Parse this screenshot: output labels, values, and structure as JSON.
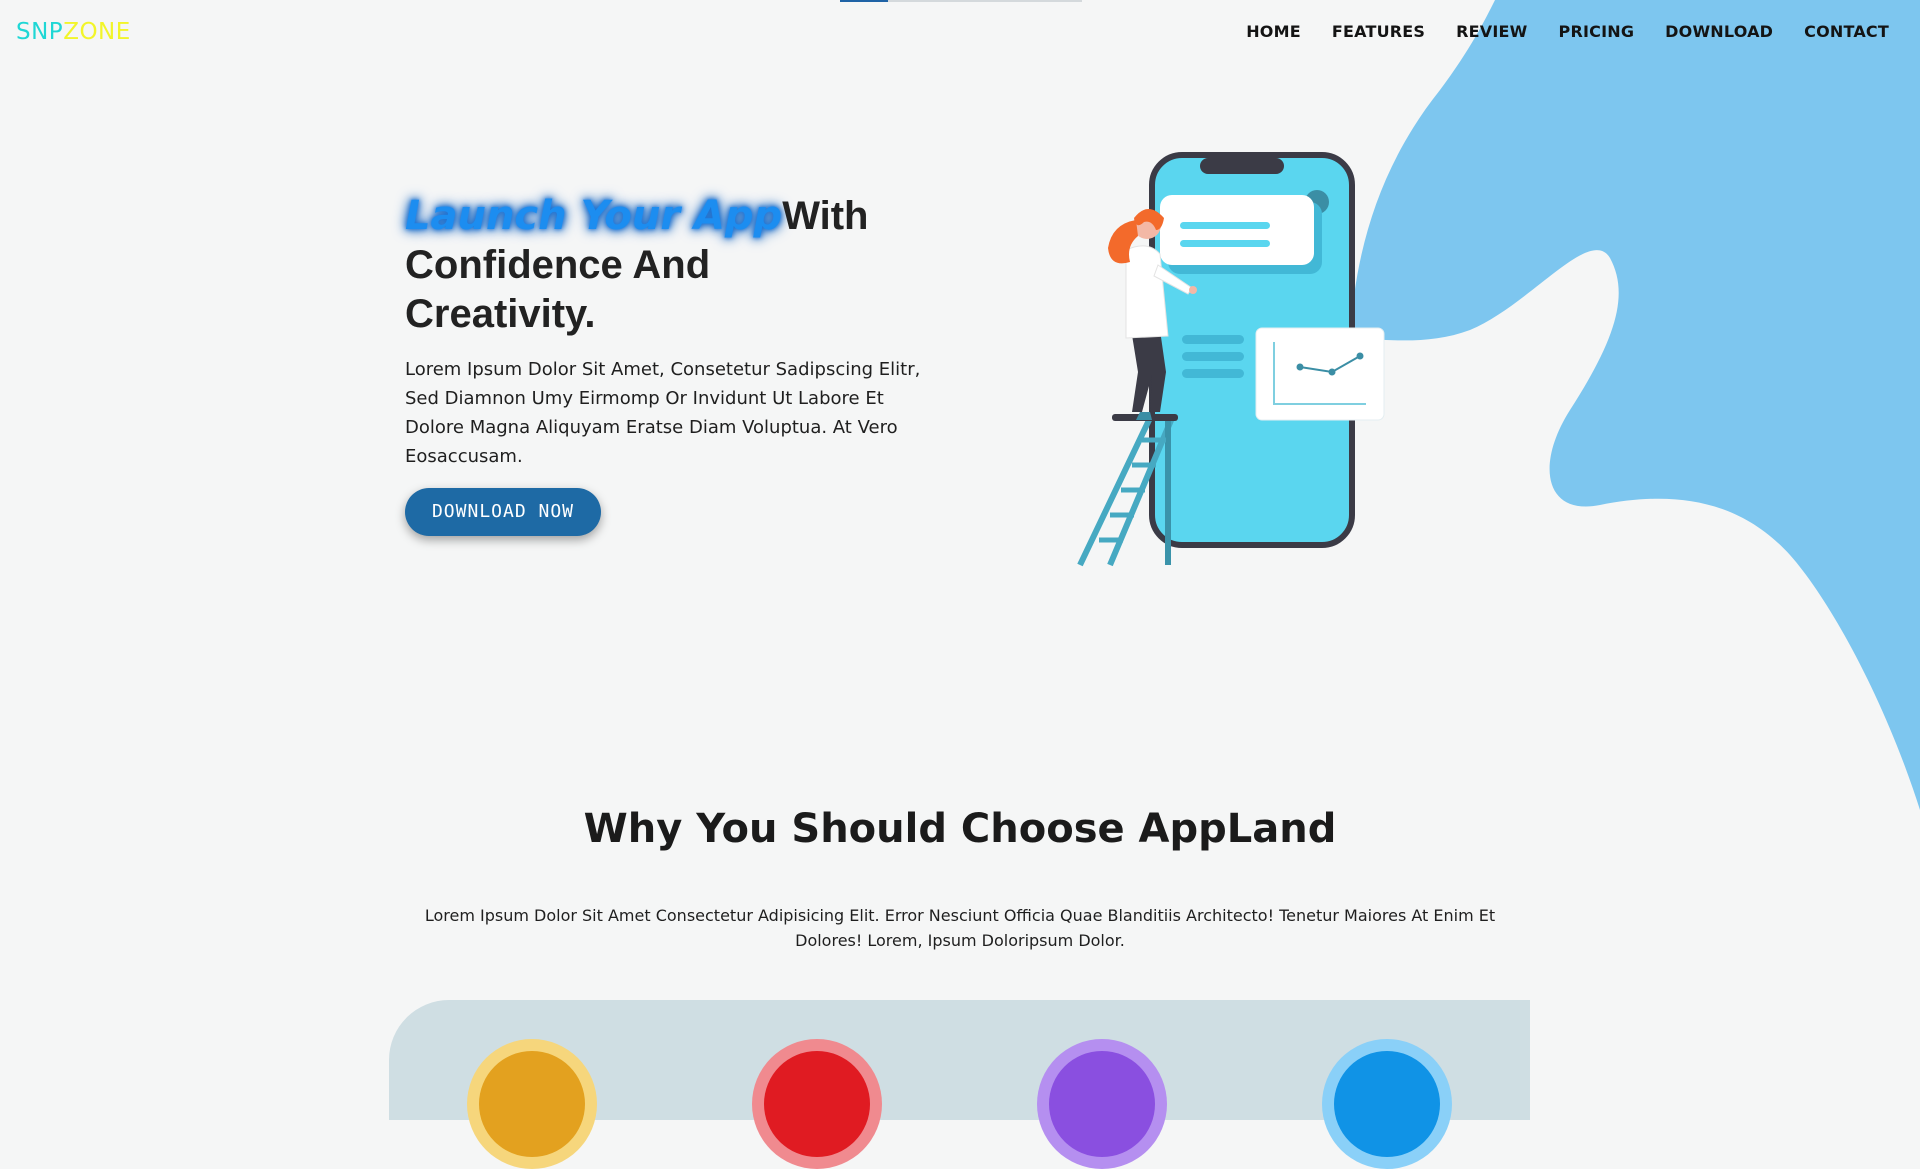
{
  "brand": {
    "part1": "SNP",
    "part2": "ZONE"
  },
  "nav": {
    "items": [
      "HOME",
      "FEATURES",
      "REVIEW",
      "PRICING",
      "DOWNLOAD",
      "CONTACT"
    ]
  },
  "hero": {
    "title_highlight": "Launch Your App",
    "title_rest_1": "With",
    "title_rest_2": "Confidence And",
    "title_rest_3": "Creativity.",
    "description": "Lorem Ipsum Dolor Sit Amet, Consetetur Sadipscing Elitr, Sed Diamnon Umy Eirmomp Or Invidunt Ut Labore Et Dolore Magna Aliquyam Eratse Diam Voluptua. At Vero Eosaccusam.",
    "cta_label": "DOWNLOAD NOW"
  },
  "features": {
    "title": "Why You Should Choose AppLand",
    "description": "Lorem Ipsum Dolor Sit Amet Consectetur Adipisicing Elit. Error Nesciunt Officia Quae Blanditiis Architecto! Tenetur Maiores At Enim Et Dolores! Lorem, Ipsum Doloripsum Dolor.",
    "icons": [
      {
        "name": "feature-icon-yellow",
        "outer": "#f6d67c",
        "inner": "#e3a11f"
      },
      {
        "name": "feature-icon-red",
        "outer": "#f08a8f",
        "inner": "#e01b22"
      },
      {
        "name": "feature-icon-purple",
        "outer": "#b58ff0",
        "inner": "#8a4fe0"
      },
      {
        "name": "feature-icon-blue",
        "outer": "#8ad0f8",
        "inner": "#1093e6"
      }
    ]
  },
  "colors": {
    "background": "#f5f6f6",
    "blob": "#7dc6ef",
    "accent": "#1e6aa5",
    "logo_part1": "#1fd7d5",
    "logo_part2": "#f2f52a"
  }
}
